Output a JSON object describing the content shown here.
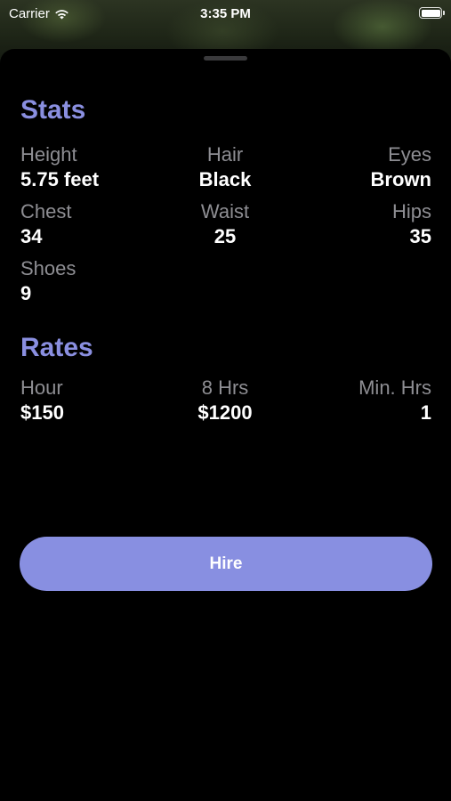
{
  "status_bar": {
    "carrier": "Carrier",
    "time": "3:35 PM",
    "wifi_icon": "wifi-icon",
    "battery_icon": "battery-full-icon"
  },
  "stats": {
    "title": "Stats",
    "items": [
      {
        "label": "Height",
        "value": "5.75 feet"
      },
      {
        "label": "Hair",
        "value": "Black"
      },
      {
        "label": "Eyes",
        "value": "Brown"
      },
      {
        "label": "Chest",
        "value": "34"
      },
      {
        "label": "Waist",
        "value": "25"
      },
      {
        "label": "Hips",
        "value": "35"
      },
      {
        "label": "Shoes",
        "value": "9"
      }
    ]
  },
  "rates": {
    "title": "Rates",
    "items": [
      {
        "label": "Hour",
        "value": "$150"
      },
      {
        "label": "8 Hrs",
        "value": "$1200"
      },
      {
        "label": "Min. Hrs",
        "value": "1"
      }
    ]
  },
  "hire_button": {
    "label": "Hire"
  },
  "colors": {
    "accent": "#8a8fe0",
    "button": "#888fe1",
    "background": "#000000",
    "label_gray": "#8e8e93",
    "value_white": "#ffffff"
  }
}
